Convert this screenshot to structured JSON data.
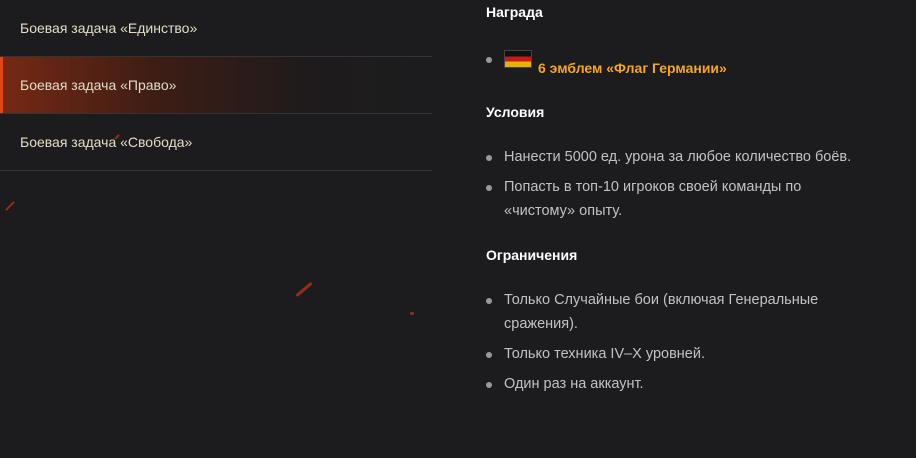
{
  "sidebar": {
    "tabs": [
      {
        "label": "Боевая задача «Единство»"
      },
      {
        "label": "Боевая задача «Право»"
      },
      {
        "label": "Боевая задача «Свобода»"
      }
    ],
    "active_index": 1
  },
  "details": {
    "reward": {
      "heading": "Награда",
      "items": [
        {
          "icon": "german-flag-icon",
          "text": "6 эмблем «Флаг Германии»"
        }
      ]
    },
    "conditions": {
      "heading": "Условия",
      "items": [
        "Нанести 5000 ед. урона за любое количество боёв.",
        "Попасть в топ-10 игроков своей команды по «чистому» опыту."
      ]
    },
    "restrictions": {
      "heading": "Ограничения",
      "items": [
        "Только Случайные бои (включая Генеральные сражения).",
        "Только техника IV–X уровней.",
        "Один раз на аккаунт."
      ]
    }
  },
  "colors": {
    "background": "#1c1c1e",
    "accent": "#e0461c",
    "reward_text": "#f5a623"
  }
}
